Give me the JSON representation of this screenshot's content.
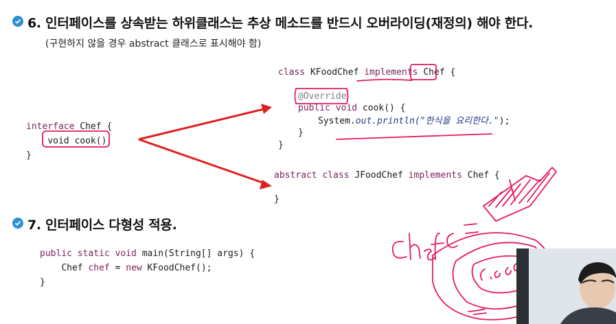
{
  "section6": {
    "number": "6.",
    "title": "인터페이스를 상속받는 하위클래스는 추상 메소드를 반드시 오버라이딩(재정의) 해야 한다.",
    "subtitle": "(구현하지 않을 경우 abstract 클래스로 표시해야 함)"
  },
  "interface_code": {
    "line1_kw": "interface",
    "line1_rest": " Chef {",
    "line2": "void cook();",
    "line3": "}"
  },
  "kfood_code": {
    "line1_kw1": "class",
    "line1_name": " KFoodChef ",
    "line1_kw2": "implements",
    "line1_iface": "Chef",
    "line1_end": " {",
    "override": "@Override",
    "method_kw": "public void",
    "method_rest": " cook() {",
    "print_prefix": "System.",
    "print_out": "out",
    "print_method": ".println(",
    "print_str": "\"한식을 요리한다.\"",
    "print_end": ");",
    "close_inner": "}",
    "close_outer": "}"
  },
  "jfood_code": {
    "kw1": "abstract class",
    "name": " JFoodChef ",
    "kw2": "implements",
    "rest": " Chef {",
    "close": "}"
  },
  "section7": {
    "number": "7.",
    "title": "인터페이스 다형성 적용."
  },
  "main_code": {
    "sig_kw": "public static void",
    "sig_rest": " main(String[] args) {",
    "body_type": "Chef ",
    "body_var": "chef",
    "body_eq": " = ",
    "body_new": "new",
    "body_rest": " KFoodChef();",
    "close": "}"
  },
  "colors": {
    "bullet": "#2b8fd6",
    "ink": "#e6195a",
    "arrow": "#e02020"
  }
}
